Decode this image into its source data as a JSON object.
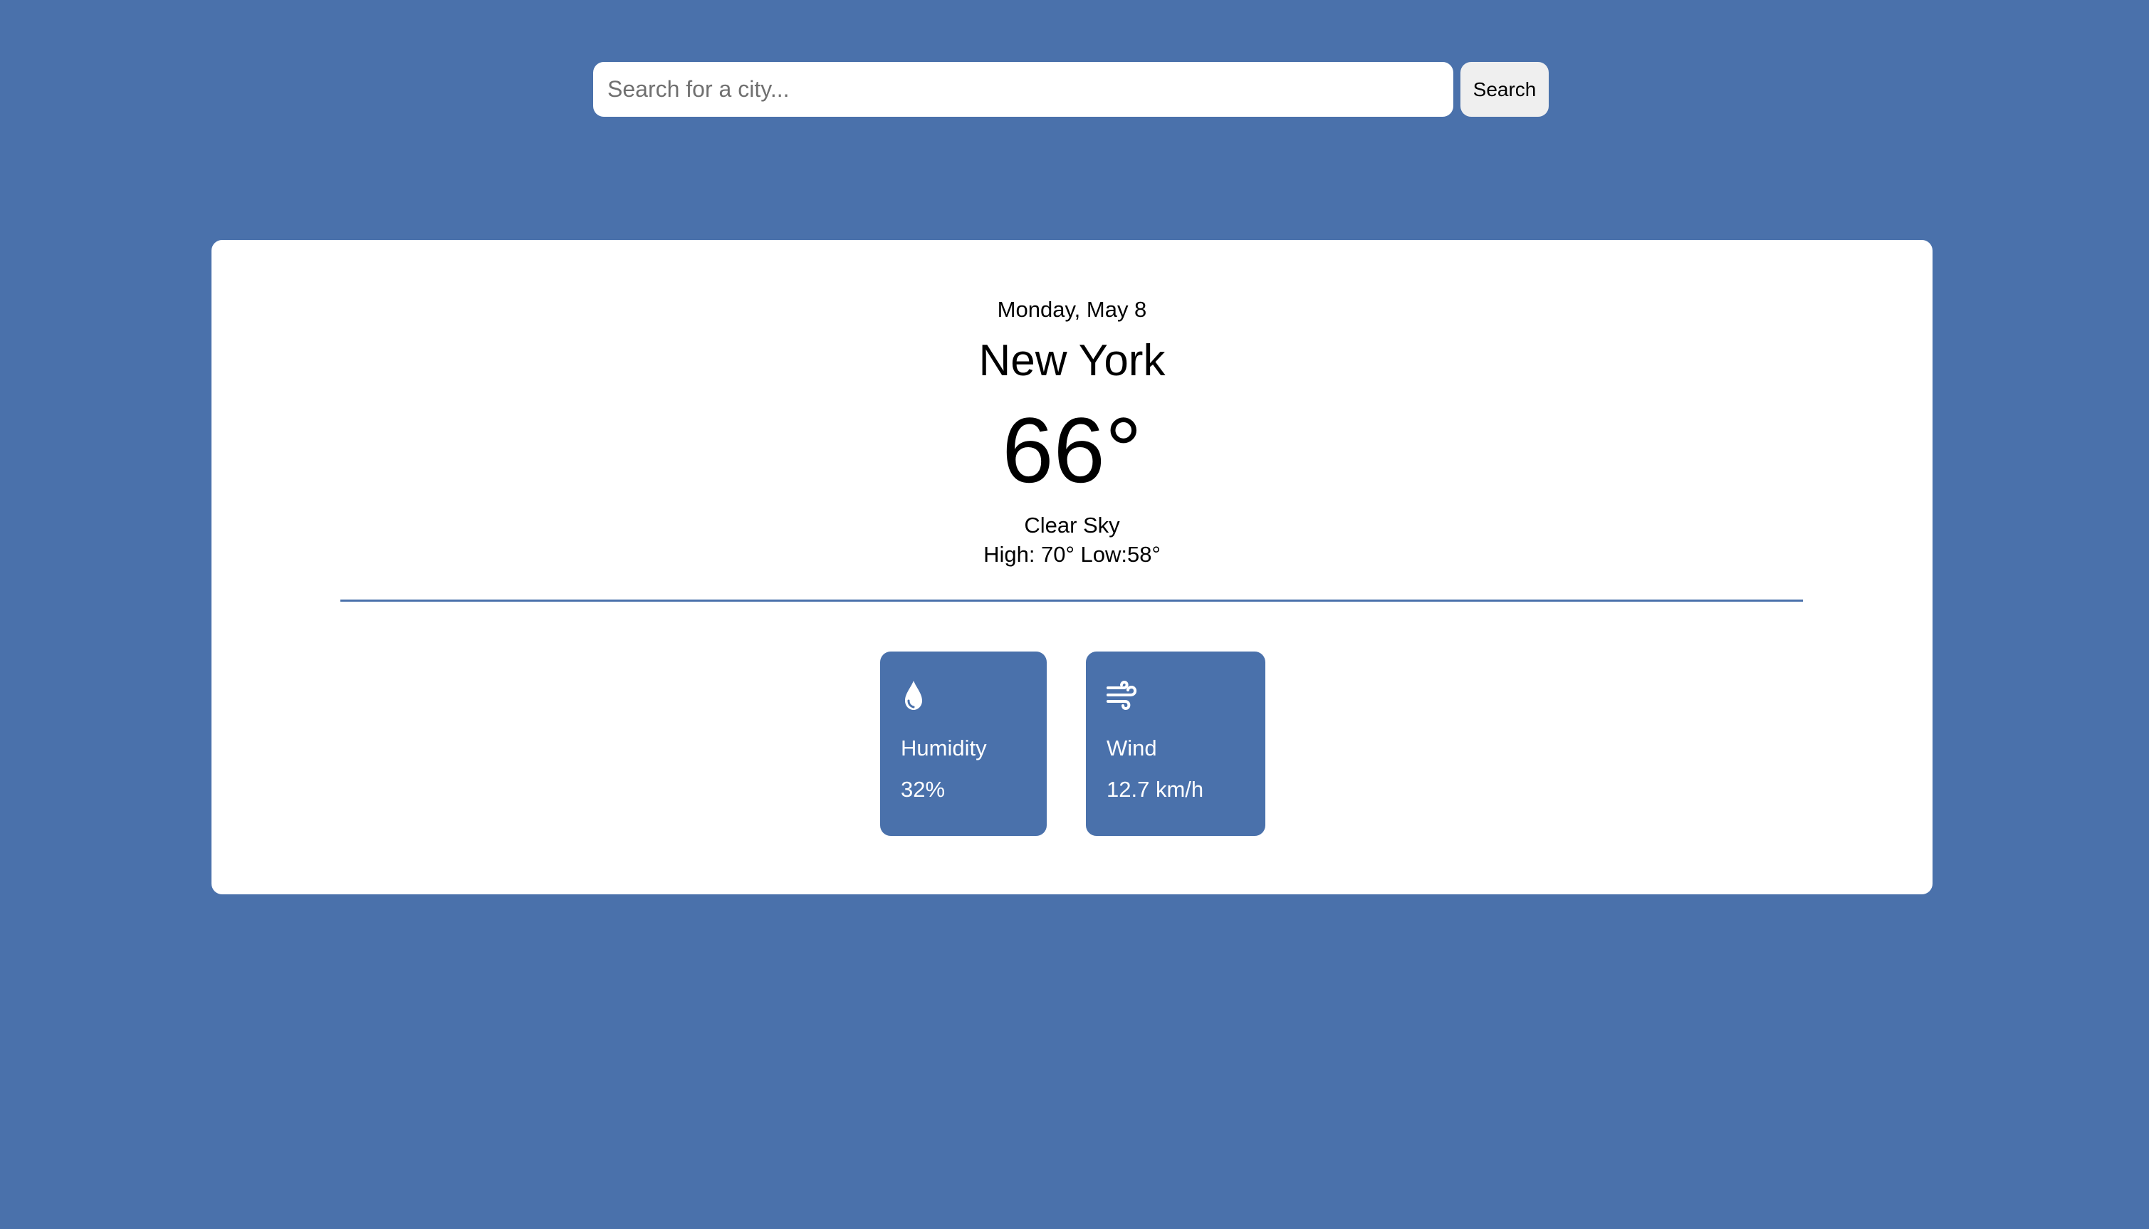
{
  "search": {
    "placeholder": "Search for a city...",
    "value": "",
    "button_label": "Search"
  },
  "weather": {
    "date": "Monday, May 8",
    "city": "New York",
    "temperature": "66°",
    "condition": "Clear Sky",
    "high_low": "High: 70° Low:58°"
  },
  "stats": {
    "humidity": {
      "icon": "water-drop-icon",
      "label": "Humidity",
      "value": "32%"
    },
    "wind": {
      "icon": "wind-icon",
      "label": "Wind",
      "value": "12.7 km/h"
    }
  },
  "colors": {
    "background": "#4a71ab",
    "card": "#ffffff",
    "accent": "#4a71ab",
    "button": "#efefef"
  }
}
